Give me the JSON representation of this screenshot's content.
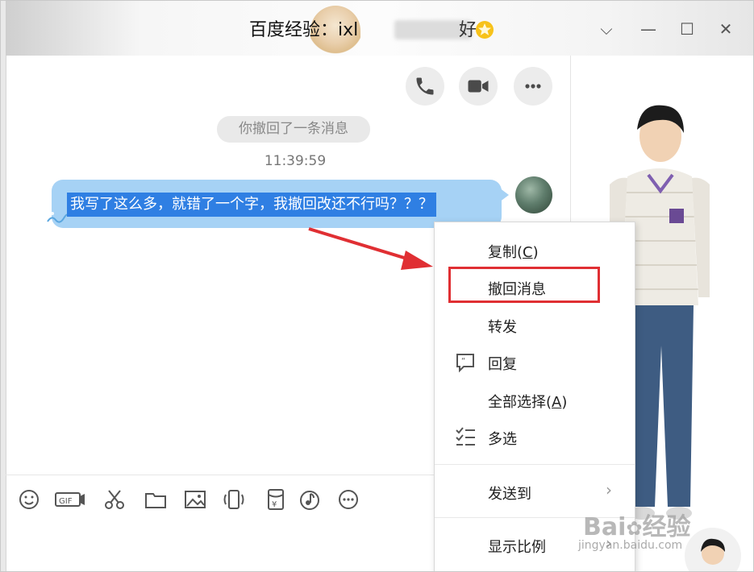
{
  "window": {
    "title_prefix": "百度经验：ixl",
    "title_suffix": "好",
    "controls": {
      "dropdown": "⌵",
      "minimize": "—",
      "maximize": "☐",
      "close": "✕"
    }
  },
  "header_actions": [
    "phone-icon",
    "video-camera-icon",
    "more-icon"
  ],
  "chat": {
    "system_notice": "你撤回了一条消息",
    "timestamp": "11:39:59",
    "message_text": "我写了这么多，就错了一个字，我撤回改还不行吗？？？"
  },
  "context_menu": {
    "items": [
      {
        "label": "复制(",
        "hotkey": "C",
        "close": ")"
      },
      {
        "label": "撤回消息"
      },
      {
        "label": "转发"
      },
      {
        "label": "回复",
        "icon": "reply-quote-icon"
      },
      {
        "label": "全部选择(",
        "hotkey": "A",
        "close": ")"
      },
      {
        "label": "多选",
        "icon": "multi-select-icon"
      },
      {
        "label": "发送到",
        "submenu": "›"
      },
      {
        "label": "显示比例",
        "submenu": "›"
      }
    ],
    "highlighted_item": "撤回消息",
    "highlight_color": "#e02f33"
  },
  "toolbar": [
    "emoji-icon",
    "gif-icon",
    "scissors-icon",
    "folder-icon",
    "image-icon",
    "shake-icon",
    "red-packet-icon",
    "music-icon",
    "more-circle-icon"
  ],
  "watermark": {
    "brand": "Bai",
    "brand_tail": "经验",
    "url": "jingyan.baidu.com"
  },
  "colors": {
    "bubble": "#a6d2f5",
    "selection": "#2f7fe3",
    "annotation": "#e02f33"
  }
}
